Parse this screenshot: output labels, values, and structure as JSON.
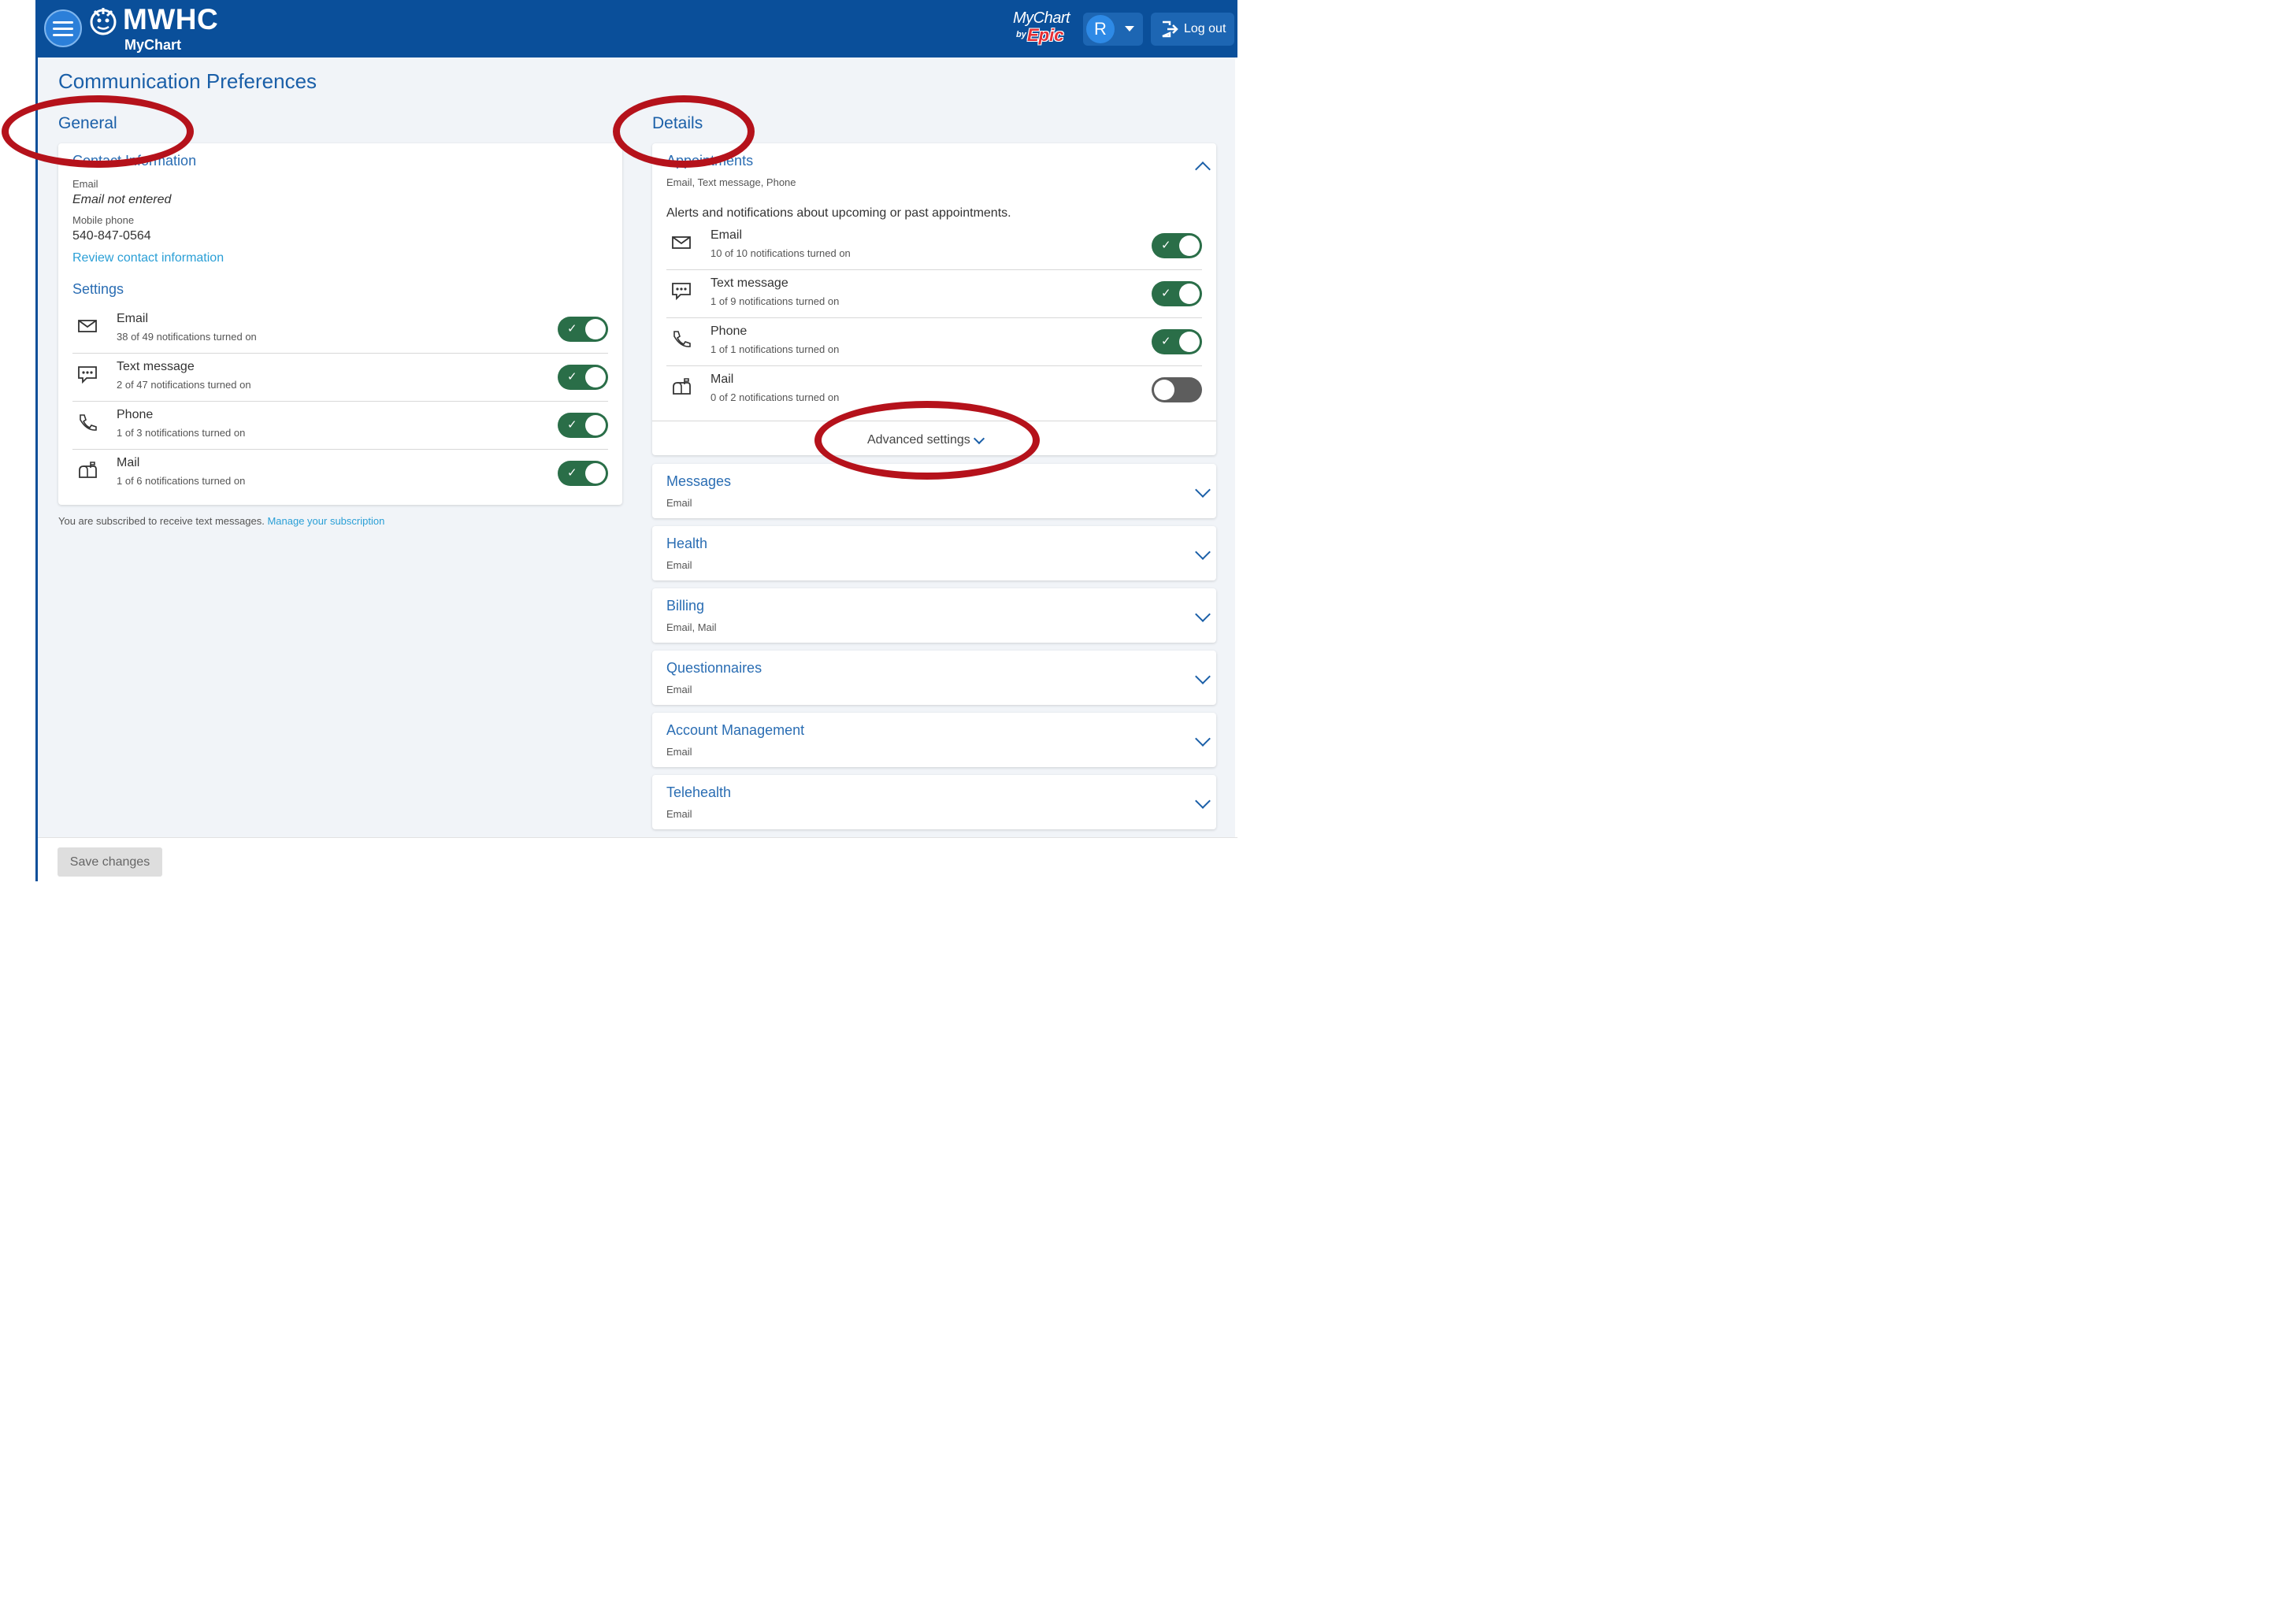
{
  "header": {
    "menu_label": "Menu",
    "brand_name": "MWHC",
    "brand_sub": "MyChart",
    "partner_logo_top": "MyChart",
    "partner_logo_by": "by",
    "partner_logo_epic": "Epic",
    "user_initial": "R",
    "logout_label": "Log out",
    "brand_color": "#0a4f9a"
  },
  "page": {
    "title": "Communication Preferences"
  },
  "general": {
    "heading": "General",
    "contact": {
      "heading": "Contact Information",
      "email_label": "Email",
      "email_value": "Email not entered",
      "phone_label": "Mobile phone",
      "phone_value": "540-847-0564",
      "review_link": "Review contact information"
    },
    "settings": {
      "heading": "Settings",
      "rows": [
        {
          "icon": "envelope-icon",
          "title": "Email",
          "sub": "38 of 49 notifications turned on",
          "on": true
        },
        {
          "icon": "chat-bubble-icon",
          "title": "Text message",
          "sub": "2 of 47 notifications turned on",
          "on": true
        },
        {
          "icon": "phone-icon",
          "title": "Phone",
          "sub": "1 of 3 notifications turned on",
          "on": true
        },
        {
          "icon": "mailbox-icon",
          "title": "Mail",
          "sub": "1 of 6 notifications turned on",
          "on": true
        }
      ]
    },
    "subscription_text": "You are subscribed to receive text messages.",
    "subscription_link": "Manage your subscription"
  },
  "details": {
    "heading": "Details",
    "appointments": {
      "title": "Appointments",
      "channels": "Email, Text message, Phone",
      "description": "Alerts and notifications about upcoming or past appointments.",
      "rows": [
        {
          "icon": "envelope-icon",
          "title": "Email",
          "sub": "10 of 10 notifications turned on",
          "on": true
        },
        {
          "icon": "chat-bubble-icon",
          "title": "Text message",
          "sub": "1 of 9 notifications turned on",
          "on": true
        },
        {
          "icon": "phone-icon",
          "title": "Phone",
          "sub": "1 of 1 notifications turned on",
          "on": true
        },
        {
          "icon": "mailbox-icon",
          "title": "Mail",
          "sub": "0 of 2 notifications turned on",
          "on": false
        }
      ],
      "advanced_label": "Advanced settings"
    },
    "categories": [
      {
        "title": "Messages",
        "channels": "Email"
      },
      {
        "title": "Health",
        "channels": "Email"
      },
      {
        "title": "Billing",
        "channels": "Email, Mail"
      },
      {
        "title": "Questionnaires",
        "channels": "Email"
      },
      {
        "title": "Account Management",
        "channels": "Email"
      },
      {
        "title": "Telehealth",
        "channels": "Email"
      }
    ]
  },
  "footer": {
    "save_label": "Save changes"
  },
  "colors": {
    "toggle_on": "#2a6e48",
    "toggle_off": "#5d5d5d",
    "link": "#2a9fd6",
    "heading": "#1a5fa8",
    "annotation_ring": "#b5121b"
  }
}
